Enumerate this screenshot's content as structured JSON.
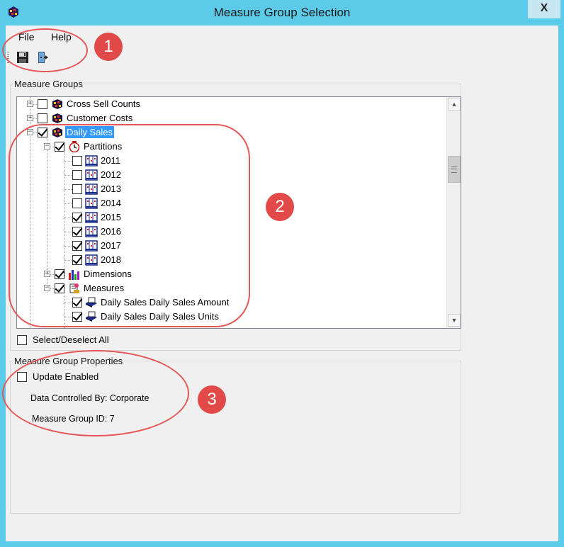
{
  "window": {
    "title": "Measure Group Selection",
    "close_label": "X"
  },
  "menu": [
    "File",
    "Help"
  ],
  "toolbar": {
    "save_icon": "save-icon",
    "exit_icon": "exit-icon"
  },
  "measure_groups": {
    "legend": "Measure Groups",
    "tree": {
      "cross_sell": "Cross Sell Counts",
      "customer_costs": "Customer Costs",
      "daily_sales": "Daily Sales",
      "partitions": "Partitions",
      "years": [
        "2011",
        "2012",
        "2013",
        "2014",
        "2015",
        "2016",
        "2017",
        "2018"
      ],
      "years_checked": [
        false,
        false,
        false,
        false,
        true,
        true,
        true,
        true
      ],
      "dimensions": "Dimensions",
      "measures": "Measures",
      "measure_items": [
        "Daily Sales Daily Sales Amount",
        "Daily Sales Daily Sales Units"
      ]
    },
    "select_all": "Select/Deselect All"
  },
  "properties": {
    "legend": "Measure Group Properties",
    "update_enabled": "Update Enabled",
    "data_controlled_by": "Data Controlled By: Corporate",
    "measure_group_id": "Measure Group ID: 7"
  },
  "annotations": [
    "1",
    "2",
    "3"
  ],
  "colors": {
    "titlebar": "#5ccbea",
    "selection": "#3399ff",
    "callout": "#e24a4a"
  }
}
